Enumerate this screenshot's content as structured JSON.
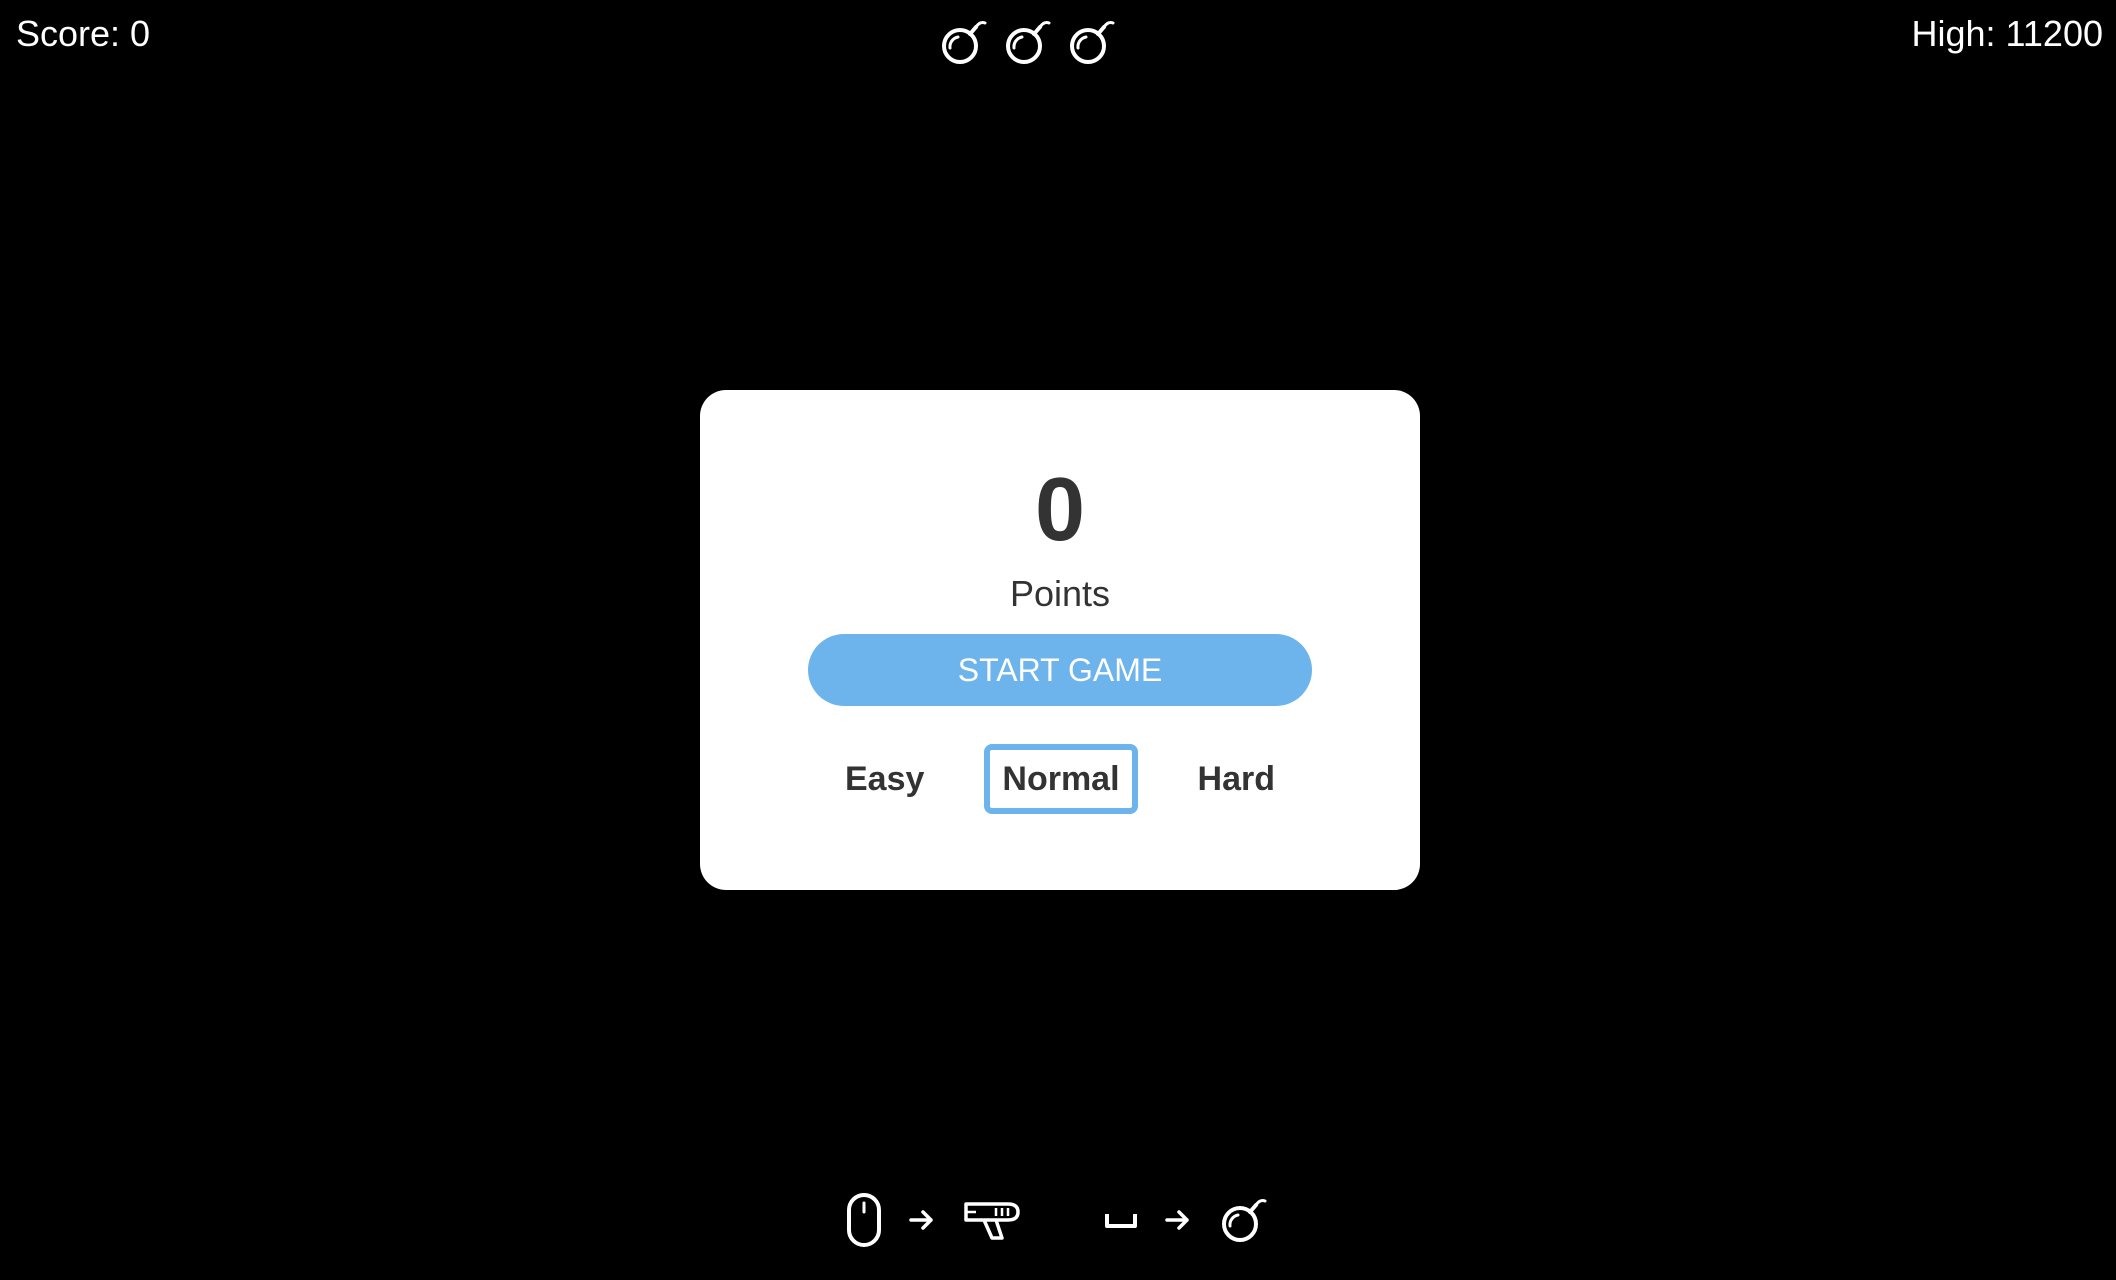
{
  "hud": {
    "score_text": "Score: 0",
    "high_text": "High: 11200",
    "bombs": [
      "bomb-icon",
      "bomb-icon",
      "bomb-icon"
    ]
  },
  "menu": {
    "score": "0",
    "points_label": "Points",
    "start_label": "START GAME",
    "difficulties": [
      "Easy",
      "Normal",
      "Hard"
    ],
    "selected_difficulty": "Normal",
    "accent_color": "#6db4ec"
  },
  "controls": {
    "shoot": {
      "input_icon": "mouse-icon",
      "arrow_icon": "arrow-right-icon",
      "action_icon": "blaster-icon"
    },
    "bomb": {
      "input_icon": "spacebar-icon",
      "arrow_icon": "arrow-right-icon",
      "action_icon": "bomb-icon"
    }
  }
}
